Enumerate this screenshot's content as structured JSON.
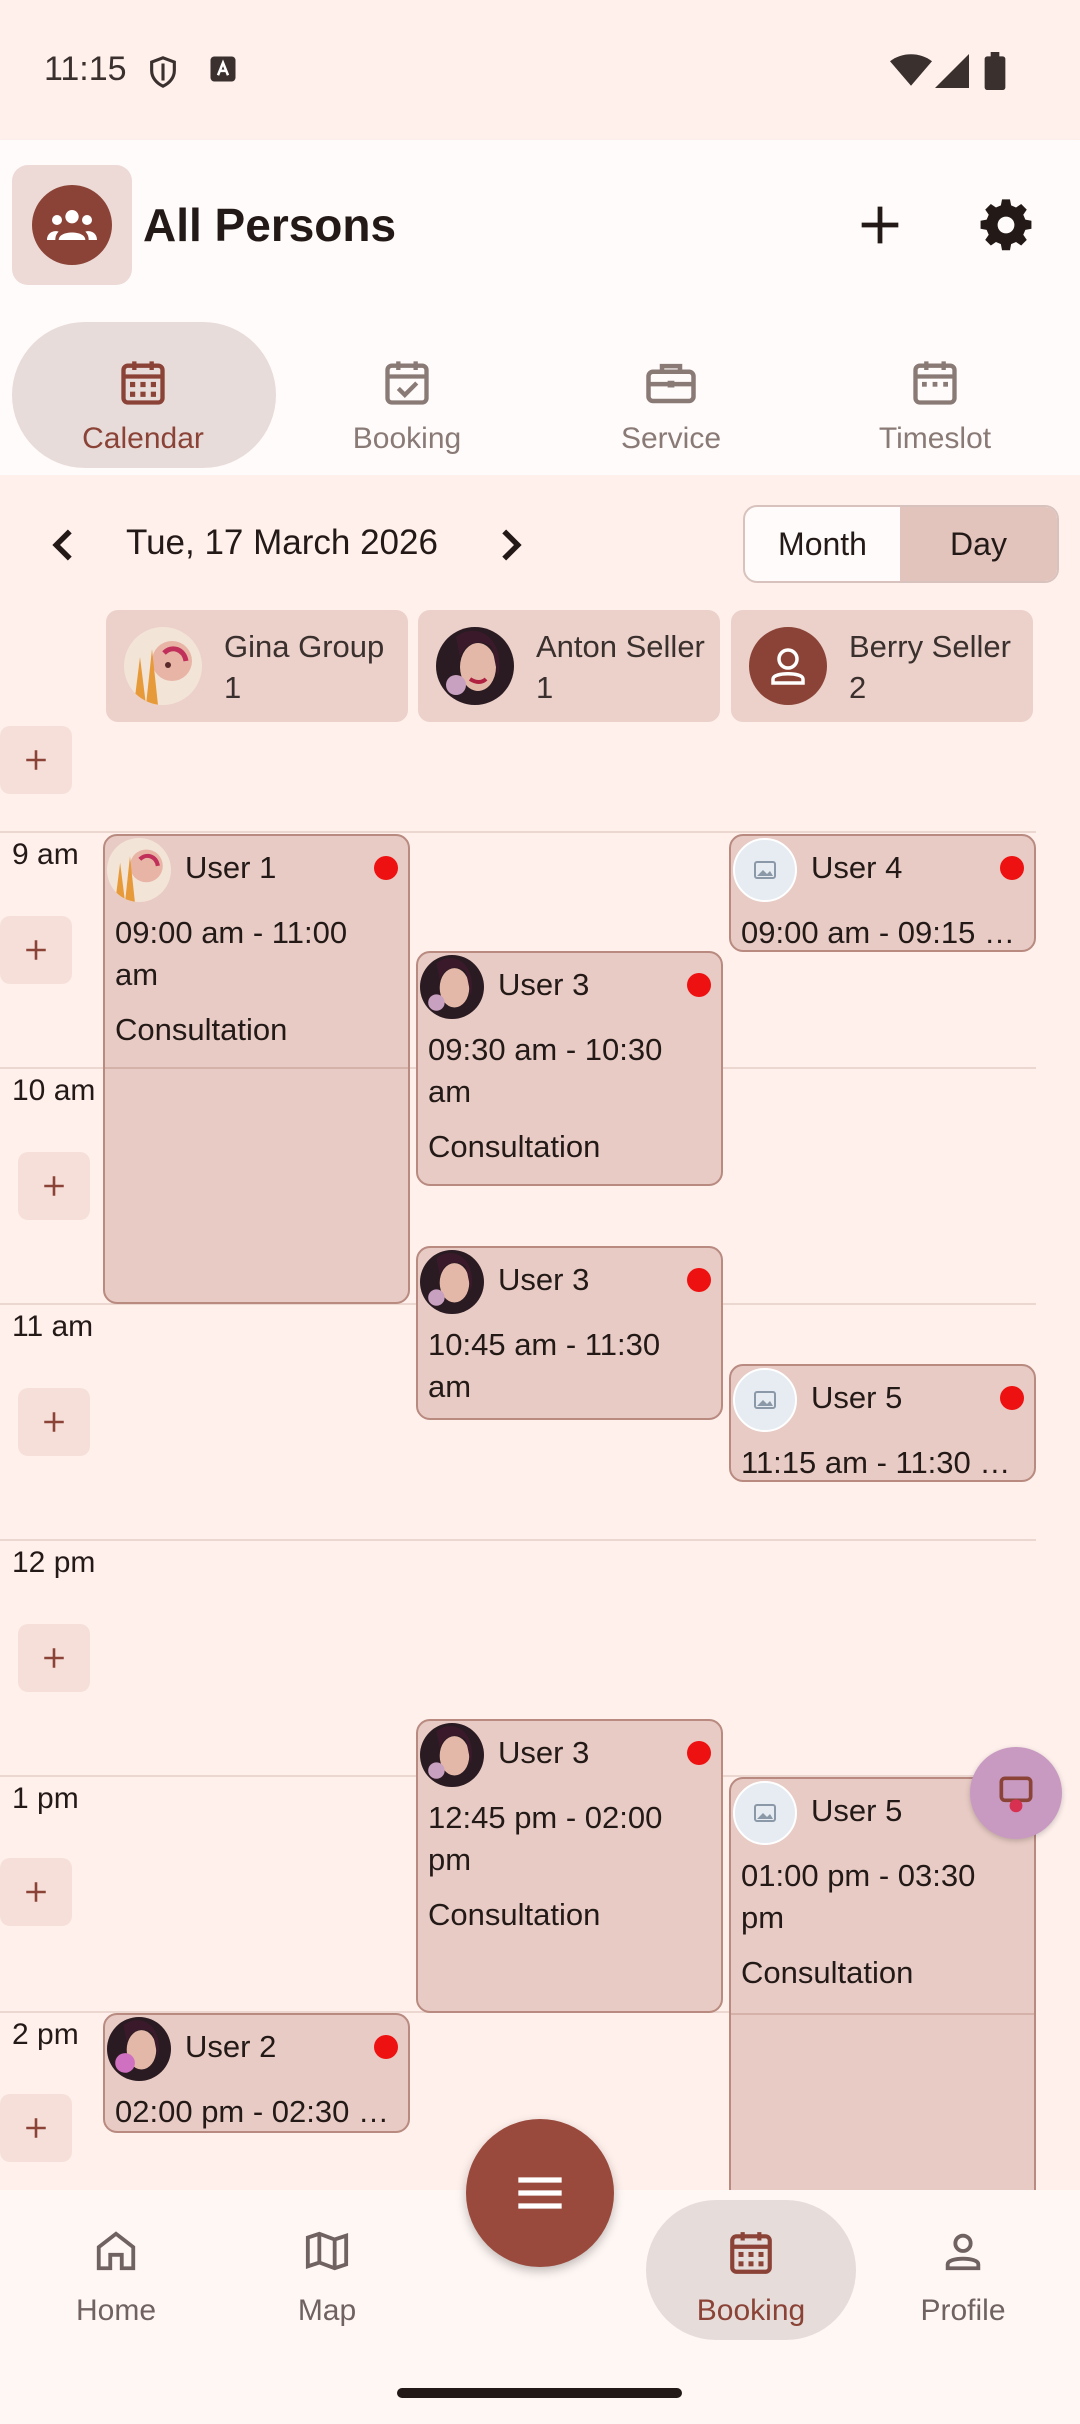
{
  "status_bar": {
    "time": "11:15"
  },
  "app_bar": {
    "title": "All Persons"
  },
  "tabs": [
    {
      "label": "Calendar"
    },
    {
      "label": "Booking"
    },
    {
      "label": "Service"
    },
    {
      "label": "Timeslot"
    }
  ],
  "date_nav": {
    "date": "Tue, 17 March 2026"
  },
  "view_toggle": {
    "month": "Month",
    "day": "Day",
    "selected": "Day"
  },
  "staff": [
    {
      "name": "Gina Group 1"
    },
    {
      "name": "Anton Seller 1"
    },
    {
      "name": "Berry Seller 2"
    }
  ],
  "time_labels": [
    "9 am",
    "10 am",
    "11 am",
    "12 pm",
    "1 pm",
    "2 pm"
  ],
  "appointments": [
    {
      "user": "User 1",
      "time": "09:00 am - 11:00 am",
      "service": "Consultation"
    },
    {
      "user": "User 3",
      "time": "09:30 am - 10:30 am",
      "service": "Consultation"
    },
    {
      "user": "User 4",
      "time": "09:00 am - 09:15 …"
    },
    {
      "user": "User 3",
      "time": "10:45 am - 11:30 am"
    },
    {
      "user": "User 5",
      "time": "11:15 am - 11:30 …"
    },
    {
      "user": "User 3",
      "time": "12:45 pm - 02:00 pm",
      "service": "Consultation"
    },
    {
      "user": "User 5",
      "time": "01:00 pm - 03:30 pm",
      "service": "Consultation"
    },
    {
      "user": "User 2",
      "time": "02:00 pm - 02:30 …"
    }
  ],
  "bottom_nav": [
    {
      "label": "Home"
    },
    {
      "label": "Map"
    },
    {
      "label": "Booking"
    },
    {
      "label": "Profile"
    }
  ],
  "colors": {
    "primary": "#8a4336",
    "background": "#fff0ec",
    "appointment_fill": "#e8cbc4",
    "status_dot": "#ee1111"
  }
}
